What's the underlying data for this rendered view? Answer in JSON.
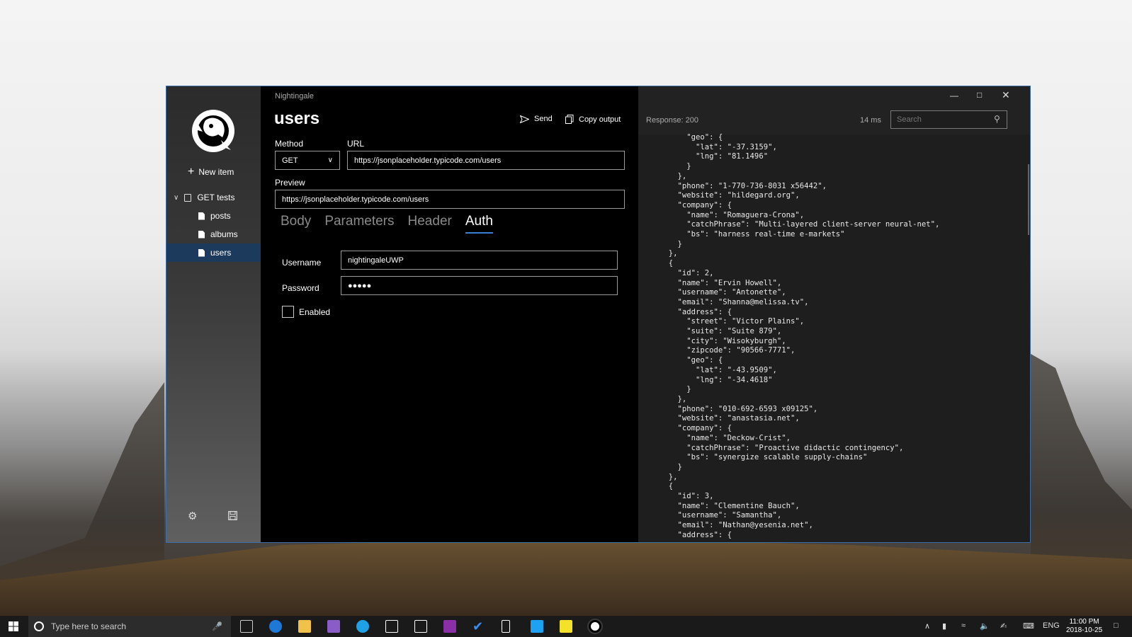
{
  "app": {
    "title": "Nightingale",
    "page_title": "users"
  },
  "toolbar": {
    "send_label": "Send",
    "copy_label": "Copy output"
  },
  "sidebar": {
    "new_item_label": "New item",
    "group_label": "GET tests",
    "items": [
      {
        "label": "posts"
      },
      {
        "label": "albums"
      },
      {
        "label": "users"
      }
    ]
  },
  "request": {
    "method_label": "Method",
    "method_value": "GET",
    "url_label": "URL",
    "url_value": "https://jsonplaceholder.typicode.com/users",
    "preview_label": "Preview",
    "preview_value": "https://jsonplaceholder.typicode.com/users"
  },
  "tabs": [
    {
      "label": "Body"
    },
    {
      "label": "Parameters"
    },
    {
      "label": "Header"
    },
    {
      "label": "Auth"
    }
  ],
  "auth": {
    "username_label": "Username",
    "username_value": "nightingaleUWP",
    "password_label": "Password",
    "password_value": "●●●●●",
    "enabled_label": "Enabled"
  },
  "response": {
    "status": "Response: 200",
    "time": "14 ms",
    "search_placeholder": "Search",
    "body": "      \"geo\": {\n        \"lat\": \"-37.3159\",\n        \"lng\": \"81.1496\"\n      }\n    },\n    \"phone\": \"1-770-736-8031 x56442\",\n    \"website\": \"hildegard.org\",\n    \"company\": {\n      \"name\": \"Romaguera-Crona\",\n      \"catchPhrase\": \"Multi-layered client-server neural-net\",\n      \"bs\": \"harness real-time e-markets\"\n    }\n  },\n  {\n    \"id\": 2,\n    \"name\": \"Ervin Howell\",\n    \"username\": \"Antonette\",\n    \"email\": \"Shanna@melissa.tv\",\n    \"address\": {\n      \"street\": \"Victor Plains\",\n      \"suite\": \"Suite 879\",\n      \"city\": \"Wisokyburgh\",\n      \"zipcode\": \"90566-7771\",\n      \"geo\": {\n        \"lat\": \"-43.9509\",\n        \"lng\": \"-34.4618\"\n      }\n    },\n    \"phone\": \"010-692-6593 x09125\",\n    \"website\": \"anastasia.net\",\n    \"company\": {\n      \"name\": \"Deckow-Crist\",\n      \"catchPhrase\": \"Proactive didactic contingency\",\n      \"bs\": \"synergize scalable supply-chains\"\n    }\n  },\n  {\n    \"id\": 3,\n    \"name\": \"Clementine Bauch\",\n    \"username\": \"Samantha\",\n    \"email\": \"Nathan@yesenia.net\",\n    \"address\": {"
  },
  "taskbar": {
    "search_placeholder": "Type here to search",
    "language": "ENG",
    "time": "11:00 PM",
    "date": "2018-10-25"
  },
  "colors": {
    "accent": "#3a7fd6",
    "selected_item": "#1b3a5c",
    "window_border": "#3a6ea5"
  }
}
